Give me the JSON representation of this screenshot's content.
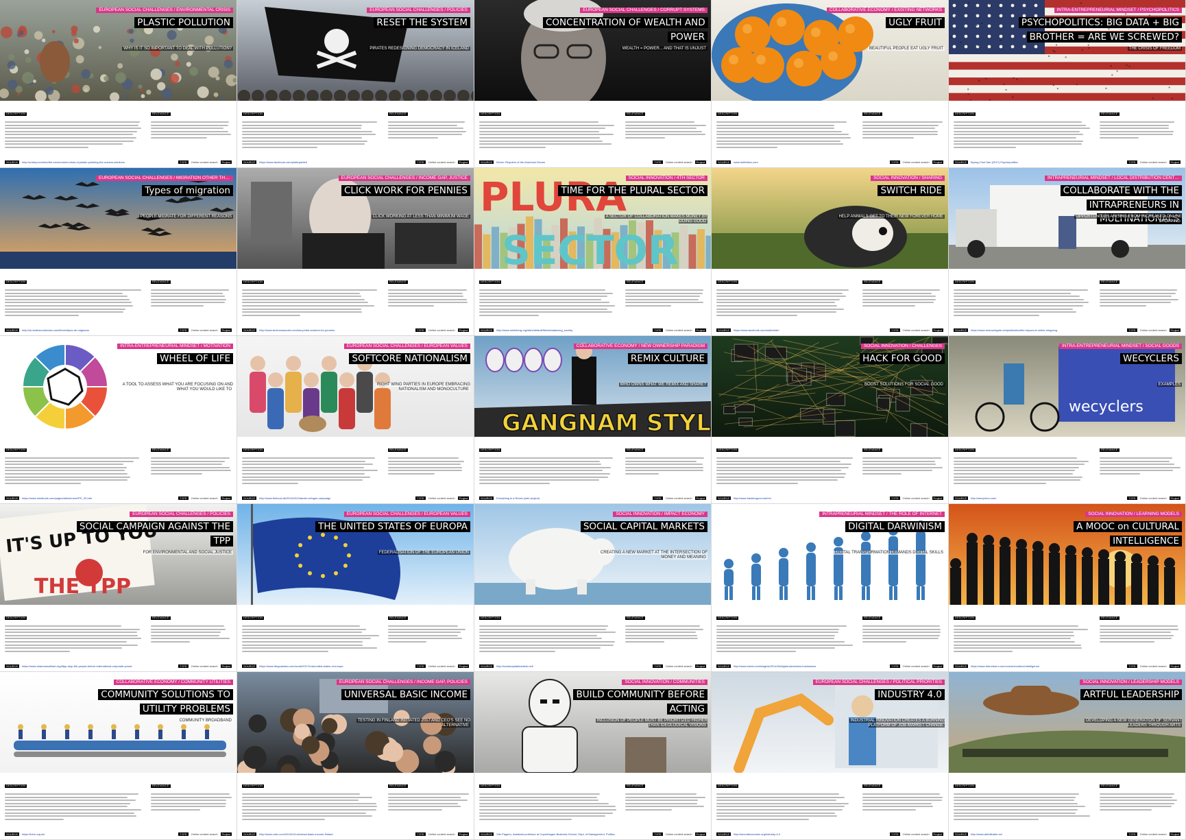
{
  "cards": [
    {
      "title": "PLASTIC POLLUTION",
      "category": "EUROPEAN SOCIAL CHALLENGES / ENVIRONMENTAL CRISIS",
      "subtitle": "Why is it so important to deal with pollution?",
      "footer_url": "http://unicity.com/hub/the-environment-crisis-of-plastic-polluting-the-oceans-solutions",
      "art": "landfill"
    },
    {
      "title": "RESET THE SYSTEM",
      "category": "EUROPEAN SOCIAL CHALLENGES / POLICIES",
      "subtitle": "PIRATES REDESIGNING DEMOCRACY IN ICELAND",
      "footer_url": "https://www.facebook.com/piratepartiet/",
      "art": "pirate-flag"
    },
    {
      "title": "CONCENTRATION OF WEALTH AND POWER",
      "category": "EUROPEAN SOCIAL CHALLENGES / CORRUPT SYSTEMS",
      "subtitle": "WEALTH = POWER... AND THAT IS UNJUST",
      "footer_url": "Movie: Requiem of the American Dream",
      "art": "portrait"
    },
    {
      "title": "UGLY FRUIT",
      "category": "COLLABORATIVE ECONOMY / EXISTING NETWORKS",
      "subtitle": "BEAUTIFUL PEOPLE EAT UGLY FRUIT",
      "footer_url": "www.fruitfulbox.com",
      "art": "oranges"
    },
    {
      "title": "PSYCHOPOLITICS: BIG DATA + BIG BROTHER = ARE WE SCREWED?",
      "category": "INTRA-ENTREPRENEURIAL MINDSET / PSYCHOPOLITICS",
      "subtitle": "The Crisis of Freedom",
      "footer_url": "Byung-Chul Han (2017) Psychopolitics",
      "art": "flag"
    },
    {
      "title": "Types of migration",
      "category": "EUROPEAN SOCIAL CHALLENGES / MIGRATION OTHER THAN REFUGEES",
      "subtitle": "People migrate for different reasons",
      "footer_url": "http://oir.lardesconhecida.com/fiches/tipos-de-migracao",
      "art": "geese"
    },
    {
      "title": "CLICK WORK FOR PENNIES",
      "category": "EUROPEAN SOCIAL CHALLENGES / INCOME GAP, JUSTICE",
      "subtitle": "CLICK WORKING AT LESS THAN MINIMUM WAGE",
      "footer_url": "http://www.technewsworld.com/story/click-workers-for-pennies",
      "art": "office"
    },
    {
      "title": "TIME FOR THE PLURAL SECTOR",
      "category": "SOCIAL INNOVATION / 4TH SECTOR",
      "subtitle": "A SECTOR OF COLLABORATION MAKES MONEY BY DOING GOOD",
      "footer_url": "http://www.mintzberg.org/sites/default/files/rebalancing_society",
      "art": "plural"
    },
    {
      "title": "SWITCH RIDE",
      "category": "SOCIAL INNOVATION / SHARING",
      "subtitle": "HELP ANIMALS GET TO THEIR NEW FOREVER HOME",
      "footer_url": "https://www.facebook.com/switchride/",
      "art": "dog"
    },
    {
      "title": "COLLABORATE WITH THE INTRAPRENEURS IN MULTINATIONALS",
      "category": "INTRAPRENEURIAL MINDSET / LOCAL DISTRIBUTION CENTERS",
      "subtitle": "Opportunities arising from increased online shopping",
      "footer_url": "https://www.researchgate.net/publication/the-impact-of-online-shopping",
      "art": "truck"
    },
    {
      "title": "WHEEL OF LIFE",
      "category": "INTRA-ENTREPRENEURIAL MINDSET / MOTIVATION",
      "subtitle": "A TOOL TO ASSESS WHAT YOU ARE FOCUSING ON AND WHAT YOU WOULD LIKE TO",
      "footer_url": "https://www.mindtools.com/pages/article/newHTE_93.htm",
      "art": "wheel"
    },
    {
      "title": "SOFTCORE NATIONALISM",
      "category": "EUROPEAN SOCIAL CHALLENGES / EUROPEAN VALUES",
      "subtitle": "RIGHT WING PARTIES IN EUROPE EMBRACING NATIONALISM AND MONOCULTURE",
      "footer_url": "http://www.thelocal.dk/20161202/danish-refugee-campaign",
      "art": "family"
    },
    {
      "title": "REMIX CULTURE",
      "category": "COLLABORATIVE ECONOMY / NEW OWNERSHIP PARADIGM",
      "subtitle": "WHO OWNS WHAT WE REMIX AND SHARE?",
      "footer_url": "Everything is a Remix (web project)",
      "art": "gangnam"
    },
    {
      "title": "HACK FOR GOOD",
      "category": "SOCIAL INNOVATION / CHALLENGES",
      "subtitle": "BOOST SOLUTIONS FOR SOCIAL GOOD",
      "footer_url": "http://www.hackforgood.net/en/",
      "art": "circuit"
    },
    {
      "title": "WECYCLERS",
      "category": "INTRA-ENTREPRENEURIAL MINDSET / SOCIAL GOODS",
      "subtitle": "EXAMPLES",
      "footer_url": "http://wecyclers.com/",
      "art": "wecyclers"
    },
    {
      "title": "SOCIAL CAMPAIGN AGAINST THE TPP",
      "category": "EUROPEAN SOCIAL CHALLENGES / POLICIES",
      "subtitle": "FOR ENVIRONMENTAL AND SOCIAL JUSTICE",
      "footer_url": "https://www.sharenowoflash.org/#tpp-stop-the-people-before-international-corporate-power",
      "art": "protest"
    },
    {
      "title": "THE UNITED STATES OF EUROPA",
      "category": "EUROPEAN SOCIAL CHALLENGES / EUROPEAN VALUES",
      "subtitle": "FEDERALISATION OF THE EUROPEAN UNION",
      "footer_url": "https://www.theguardian.com/world/2017/mar/united-states-of-europe",
      "art": "eu-flag"
    },
    {
      "title": "SOCIAL CAPITAL MARKETS",
      "category": "SOCIAL INNOVATION / IMPACT ECONOMY",
      "subtitle": "CREATING A NEW MARKET AT THE INTERSECTION OF MONEY AND MEANING",
      "footer_url": "http://socialcapitalmarkets.net/",
      "art": "piggy"
    },
    {
      "title": "DIGITAL DARWINISM",
      "category": "INTRAPRENEURIAL MINDSET / THE ROLE OF INTERNET",
      "subtitle": "Digital transformation demands digital skills",
      "footer_url": "http://www.wired.com/insights/2014/04/digital-darwinism-businesses",
      "art": "evolution"
    },
    {
      "title": "A MOOC on CULTURAL INTELLIGENCE",
      "category": "SOCIAL INNOVATION / LEARNING MODELS",
      "subtitle": "",
      "footer_url": "https://www.futurelearn.com/courses/cultural-intelligence",
      "art": "sunset"
    },
    {
      "title": "COMMUNITY SOLUTIONS TO UTILITY PROBLEMS",
      "category": "COLLABORATIVE ECONOMY / COMMUNITY UTILITIES",
      "subtitle": "COMMUNITY BROADBAND",
      "footer_url": "https://b4rn.org.uk/",
      "art": "workers"
    },
    {
      "title": "UNIVERSAL BASIC INCOME",
      "category": "EUROPEAN SOCIAL CHALLENGES / INCOME GAP, POLICIES",
      "subtitle": "TESTING IN FINLAND INITIATED 2017 AND CEO'S SEE NO ALTERNATIVE",
      "footer_url": "http://www.cnbc.com/2016/12/universal-basic-income-finland",
      "art": "crowd"
    },
    {
      "title": "BUILD COMMUNITY BEFORE ACTING",
      "category": "SOCIAL INNOVATION / COMMUNITIES",
      "subtitle": "INCLUSION OF PEOPLE MUST BE PRIORITIZED HIGHER THAN IDEOLOGICAL VISIONS",
      "footer_url": "Vito Paganu, Assistant professor at Copenhagen Business School, Dept. of Management, Politics",
      "art": "trooper"
    },
    {
      "title": "INDUSTRY 4.0",
      "category": "EUROPEAN SOCIAL CHALLENGES / POLITICAL PRIORITIES",
      "subtitle": "INDUSTRIAL INNOVATION CREATES A BURNING PLATFORM OF JOB MARKET CHANGE",
      "footer_url": "http://securiteconomic.org/industry-4-0",
      "art": "robot"
    },
    {
      "title": "ARTFUL LEADERSHIP",
      "category": "SOCIAL INNOVATION / LEADERSHIP MODELS",
      "subtitle": "DEVELOPING A NEW GENERATION OF SERVANT LEADERS THROUGH ARTS",
      "footer_url": "http://www.artfulleader.eu/",
      "art": "hat"
    }
  ],
  "labels": {
    "description": "DESCRIPTION",
    "relevance": "RELEVANCE",
    "source": "SOURCE",
    "type": "Online content search",
    "end": "Project"
  }
}
